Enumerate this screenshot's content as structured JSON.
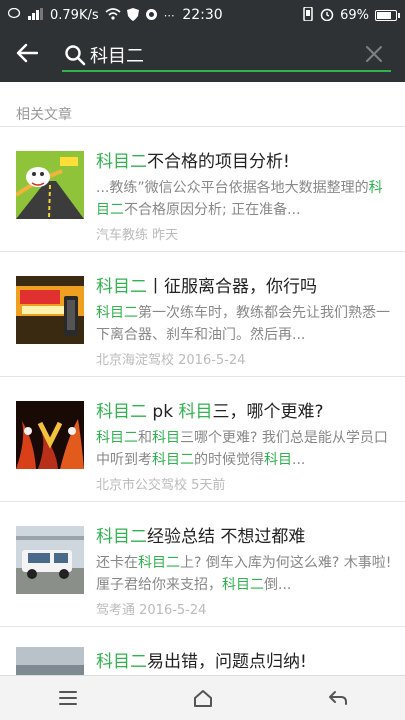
{
  "status_bar": {
    "network_speed": "0.79K/s",
    "time": "22:30",
    "battery_percent": "69%",
    "battery_level": 0.69
  },
  "search": {
    "query": "科目二",
    "placeholder": ""
  },
  "section_title": "相关文章",
  "articles": [
    {
      "title": [
        {
          "t": "科目二",
          "hl": true
        },
        {
          "t": "不合格的项目分析!",
          "hl": false
        }
      ],
      "snippet": [
        {
          "t": "...教练”微信公众平台依据各地大数据整理的",
          "hl": false
        },
        {
          "t": "科目二",
          "hl": true
        },
        {
          "t": "不合格原因分析;  正在准备...",
          "hl": false
        }
      ],
      "meta": "汽车教练  昨天"
    },
    {
      "title": [
        {
          "t": "科目二",
          "hl": true
        },
        {
          "t": "丨征服离合器，你行吗",
          "hl": false
        }
      ],
      "snippet": [
        {
          "t": "科目二",
          "hl": true
        },
        {
          "t": "第一次练车时，教练都会先让我们熟悉一下离合器、刹车和油门。然后再...",
          "hl": false
        }
      ],
      "meta": "北京海淀驾校  2016-5-24"
    },
    {
      "title": [
        {
          "t": "科目二",
          "hl": true
        },
        {
          "t": " pk ",
          "hl": false
        },
        {
          "t": "科目",
          "hl": true
        },
        {
          "t": "三，哪个更难?",
          "hl": false
        }
      ],
      "snippet": [
        {
          "t": "科目二",
          "hl": true
        },
        {
          "t": "和",
          "hl": false
        },
        {
          "t": "科目",
          "hl": true
        },
        {
          "t": "三哪个更难? 我们总是能从学员口中听到考",
          "hl": false
        },
        {
          "t": "科目二",
          "hl": true
        },
        {
          "t": "的时候觉得",
          "hl": false
        },
        {
          "t": "科目",
          "hl": true
        },
        {
          "t": "...",
          "hl": false
        }
      ],
      "meta": "北京市公交驾校  5天前"
    },
    {
      "title": [
        {
          "t": "科目二",
          "hl": true
        },
        {
          "t": "经验总结 不想过都难",
          "hl": false
        }
      ],
      "snippet": [
        {
          "t": "还卡在",
          "hl": false
        },
        {
          "t": "科目二",
          "hl": true
        },
        {
          "t": "上? 倒车入库为何这么难? 木事啦! 厘子君给你来支招，",
          "hl": false
        },
        {
          "t": "科目二",
          "hl": true
        },
        {
          "t": "倒...",
          "hl": false
        }
      ],
      "meta": "驾考通  2016-5-24"
    },
    {
      "title": [
        {
          "t": "科目二",
          "hl": true
        },
        {
          "t": "易出错，问题点归纳!",
          "hl": false
        }
      ],
      "snippet": [],
      "meta": ""
    }
  ],
  "icons": {
    "back": "arrow-left-icon",
    "search": "search-icon",
    "clear": "close-icon",
    "nav_menu": "menu-icon",
    "nav_home": "home-icon",
    "nav_back": "back-icon"
  },
  "colors": {
    "header_bg": "#2e3234",
    "accent": "#2fb34e",
    "text": "#222222",
    "muted": "#888888"
  }
}
